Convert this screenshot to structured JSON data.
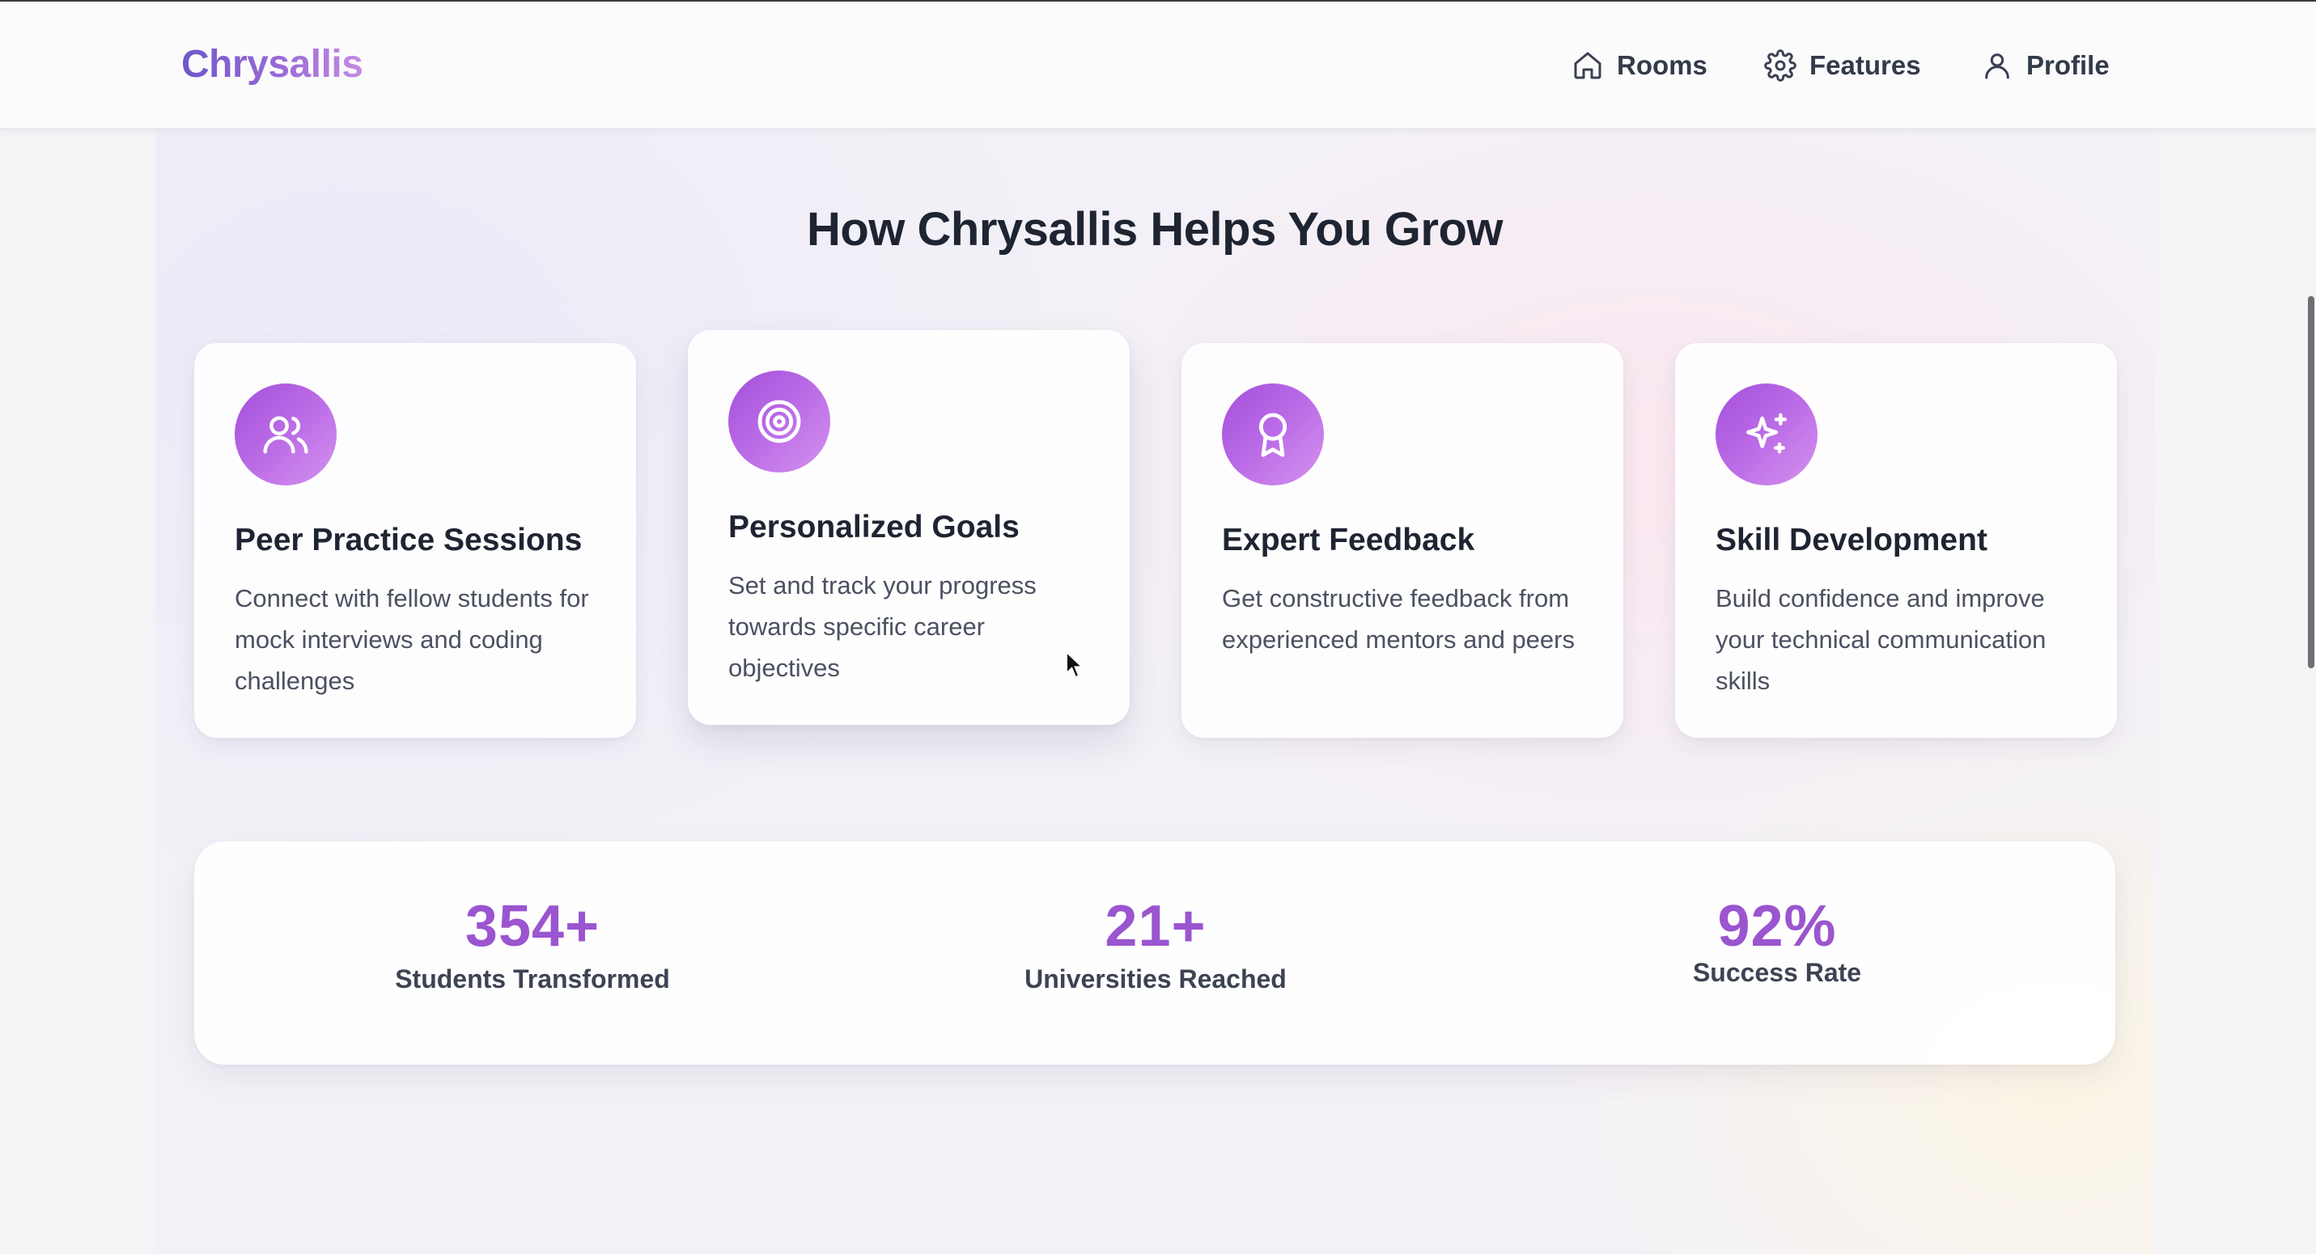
{
  "nav": {
    "brand": "Chrysallis",
    "items": [
      {
        "label": "Rooms",
        "icon": "home-icon"
      },
      {
        "label": "Features",
        "icon": "gear-icon"
      },
      {
        "label": "Profile",
        "icon": "user-icon"
      }
    ]
  },
  "section": {
    "title": "How Chrysallis Helps You Grow"
  },
  "features": [
    {
      "icon": "users-icon",
      "title": "Peer Practice Sessions",
      "description": "Connect with fellow students for mock interviews and coding challenges"
    },
    {
      "icon": "target-icon",
      "title": "Personalized Goals",
      "description": "Set and track your progress towards specific career objectives"
    },
    {
      "icon": "award-icon",
      "title": "Expert Feedback",
      "description": "Get constructive feedback from experienced mentors and peers"
    },
    {
      "icon": "sparkles-icon",
      "title": "Skill Development",
      "description": "Build confidence and improve your technical communication skills"
    }
  ],
  "stats": [
    {
      "value": "354+",
      "label": "Students Transformed"
    },
    {
      "value": "21+",
      "label": "Universities Reached"
    },
    {
      "value": "92%",
      "label": "Success Rate"
    }
  ],
  "colors": {
    "accent": "#9a55cf",
    "icon_gradient_start": "#a44fdc",
    "icon_gradient_end": "#d592ef",
    "heading": "#1e2431",
    "body_text": "#4b5161"
  }
}
